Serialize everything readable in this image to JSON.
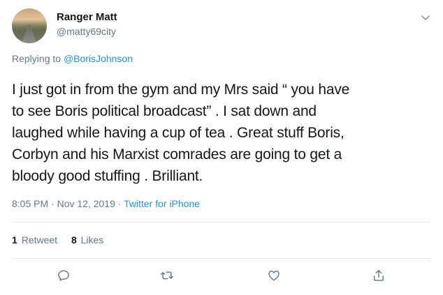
{
  "user": {
    "display_name": "Ranger Matt",
    "handle": "@matty69city"
  },
  "reply": {
    "prefix": "Replying to ",
    "target": "@BorisJohnson"
  },
  "tweet": {
    "text": "I just got in from the gym and my Mrs said “ you have\nto see Boris political broadcast” . I sat down and\nlaughed while having a cup of tea . Great stuff Boris,\nCorbyn and his Marxist comrades are going to get a\nbloody good stuffing . Brilliant."
  },
  "meta": {
    "time": "8:05 PM",
    "separator1": " · ",
    "date": "Nov 12, 2019",
    "separator2": " · ",
    "source": "Twitter for iPhone"
  },
  "stats": {
    "retweets_count": "1",
    "retweets_label": "Retweet",
    "likes_count": "8",
    "likes_label": "Likes"
  },
  "icons": {
    "menu": "chevron-down-icon",
    "reply": "reply-icon",
    "retweet": "retweet-icon",
    "like": "heart-icon",
    "share": "share-icon"
  },
  "colors": {
    "link": "#1b95e0",
    "muted": "#657786",
    "text": "#14171a",
    "divider": "#e6ecf0"
  }
}
